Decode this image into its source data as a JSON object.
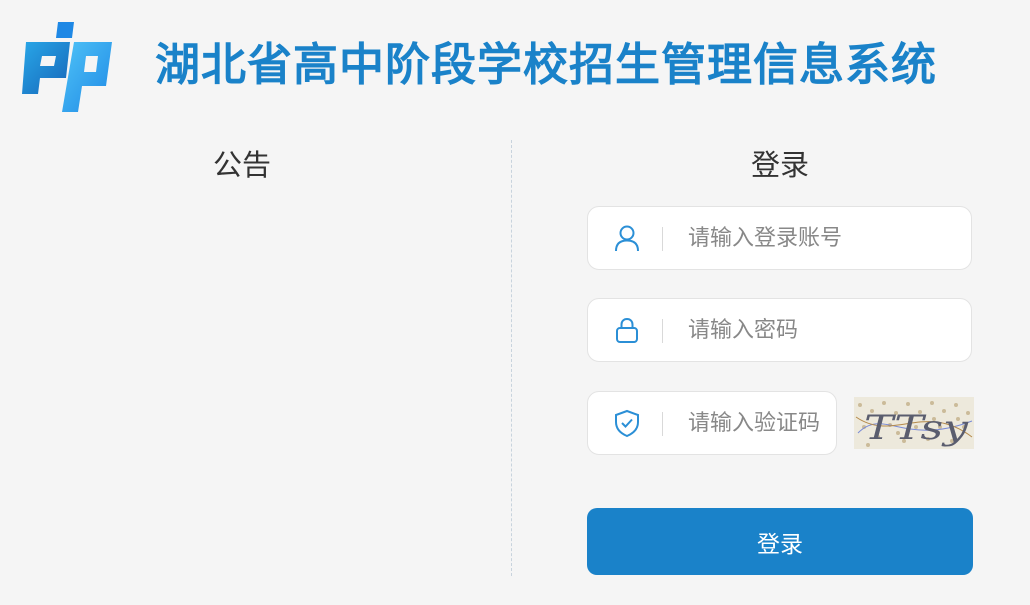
{
  "header": {
    "logo_icon": "provincial-logo-icon",
    "title": "湖北省高中阶段学校招生管理信息系统",
    "title_color": "#1a82c9"
  },
  "notice": {
    "title": "公告"
  },
  "login": {
    "title": "登录",
    "username": {
      "placeholder": "请输入登录账号",
      "value": "",
      "icon": "user-icon"
    },
    "password": {
      "placeholder": "请输入密码",
      "value": "",
      "icon": "lock-icon"
    },
    "captcha": {
      "placeholder": "请输入验证码",
      "value": "",
      "icon": "shield-check-icon",
      "image_text": "TTsy"
    },
    "submit_label": "登录",
    "accent": "#1a82c9"
  }
}
